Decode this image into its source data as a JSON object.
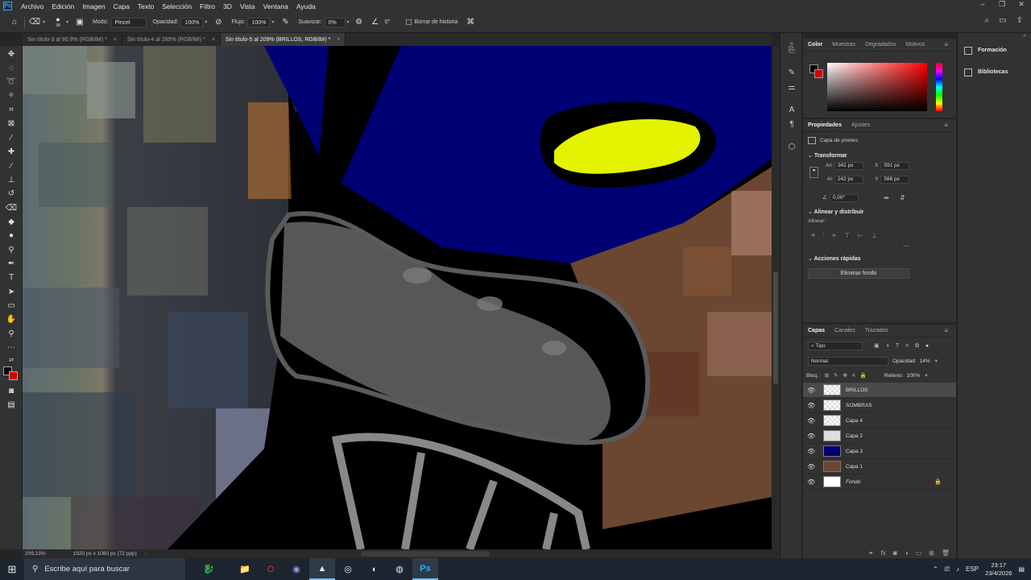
{
  "menubar": {
    "logo": "Ps",
    "items": [
      "Archivo",
      "Edición",
      "Imagen",
      "Capa",
      "Texto",
      "Selección",
      "Filtro",
      "3D",
      "Vista",
      "Ventana",
      "Ayuda"
    ]
  },
  "options": {
    "brush_size": "34",
    "mode_label": "Modo:",
    "mode_value": "Pincel",
    "opacity_label": "Opacidad:",
    "opacity_value": "100%",
    "flow_label": "Flujo:",
    "flow_value": "100%",
    "smooth_label": "Suavizar:",
    "smooth_value": "0%",
    "angle_value": "0°",
    "history_label": "Borrar de historia"
  },
  "tabs": [
    {
      "label": "Sin título-3 al 90,9% (RGB/8#) *"
    },
    {
      "label": "Sin título-4 al 285% (RGB/8#) *"
    },
    {
      "label": "Sin título-5 al 209% (BRILLOS, RGB/8#) *"
    }
  ],
  "status": {
    "zoom": "209,23%",
    "doc_size": "1920 px x 1080 px (72 ppp)"
  },
  "color_panel": {
    "tabs": [
      "Color",
      "Muestras",
      "Degradados",
      "Motivos"
    ],
    "fg": "#000000",
    "bg": "#d40000"
  },
  "far_panel": {
    "items": [
      "Formación",
      "Bibliotecas"
    ]
  },
  "properties": {
    "tabs": [
      "Propiedades",
      "Ajustes"
    ],
    "type_label": "Capa de píxeles",
    "transform_title": "Transformar",
    "an_label": "An",
    "an_value": "341 px",
    "x_label": "X",
    "x_value": "591 px",
    "al_label": "Al",
    "al_value": "242 px",
    "y_label": "Y",
    "y_value": "566 px",
    "angle_value": "0,00°",
    "align_title": "Alinear y distribuir",
    "align_label": "Alinear:",
    "quick_title": "Acciones rápidas",
    "remove_bg": "Eliminar fondo"
  },
  "layers_panel": {
    "tabs": [
      "Capas",
      "Canales",
      "Trazados"
    ],
    "filter_label": "Tipo",
    "blend_mode": "Normal",
    "opacity_label": "Opacidad:",
    "opacity_value": "14%",
    "lock_label": "Bloq.:",
    "fill_label": "Relleno:",
    "fill_value": "100%",
    "layers": [
      {
        "name": "BRILLOS"
      },
      {
        "name": "SOMBRAS"
      },
      {
        "name": "Capa 4"
      },
      {
        "name": "Capa 2"
      },
      {
        "name": "Capa 3"
      },
      {
        "name": "Capa 1"
      },
      {
        "name": "Fondo"
      }
    ]
  },
  "taskbar": {
    "search_placeholder": "Escribe aquí para buscar",
    "lang": "ESP",
    "time": "23:17",
    "date": "23/4/2026"
  }
}
